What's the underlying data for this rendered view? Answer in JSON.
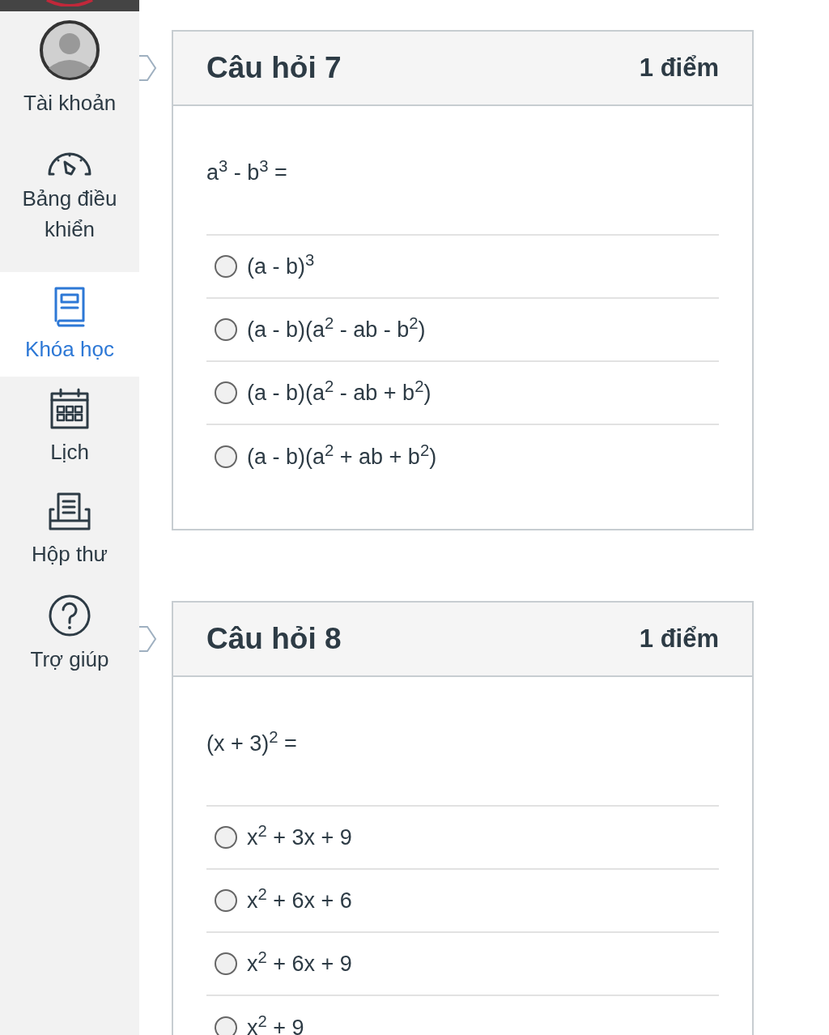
{
  "sidebar": {
    "items": [
      {
        "label": "Tài khoản",
        "selected": false
      },
      {
        "label": "Bảng điều khiển",
        "selected": false
      },
      {
        "label": "Khóa học",
        "selected": true
      },
      {
        "label": "Lịch",
        "selected": false
      },
      {
        "label": "Hộp thư",
        "selected": false
      },
      {
        "label": "Trợ giúp",
        "selected": false
      }
    ]
  },
  "questions": [
    {
      "title": "Câu hỏi 7",
      "points": "1 điểm",
      "text": "a$^{3}$ - b$^{3}$ =",
      "options": [
        {
          "label": "(a - b)$^{3}$",
          "selected": false
        },
        {
          "label": "(a - b)(a$^{2}$ - ab - b$^{2}$)",
          "selected": false
        },
        {
          "label": "(a - b)(a$^{2}$ - ab + b$^{2}$)",
          "selected": false
        },
        {
          "label": "(a - b)(a$^{2}$ + ab + b$^{2}$)",
          "selected": false
        }
      ]
    },
    {
      "title": "Câu hỏi 8",
      "points": "1 điểm",
      "text": "(x + 3)$^{2}$ =",
      "options": [
        {
          "label": "x$^{2}$ + 3x + 9",
          "selected": false
        },
        {
          "label": "x$^{2}$ + 6x + 6",
          "selected": false
        },
        {
          "label": "x$^{2}$ + 6x + 9",
          "selected": false
        },
        {
          "label": "x$^{2}$ + 9",
          "selected": false
        }
      ]
    }
  ]
}
